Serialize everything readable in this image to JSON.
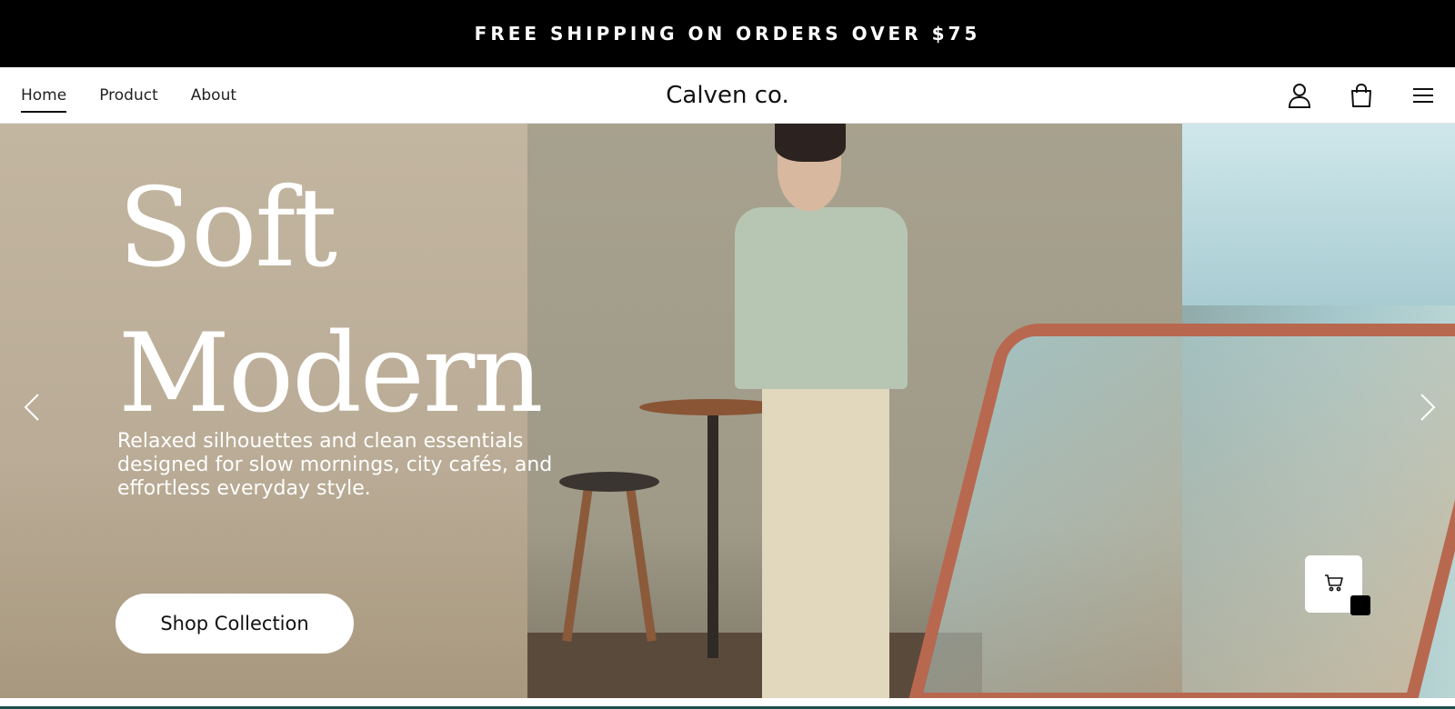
{
  "announcement": {
    "text": "FREE SHIPPING ON ORDERS OVER $75"
  },
  "nav": {
    "links": [
      {
        "label": "Home",
        "active": true
      },
      {
        "label": "Product",
        "active": false
      },
      {
        "label": "About",
        "active": false
      }
    ],
    "brand": "Calven co.",
    "icons": [
      "user-icon",
      "shopping-bag-icon",
      "menu-icon"
    ]
  },
  "hero": {
    "title_line1": "Soft",
    "title_line2": "Modern",
    "subtitle_line1": "Relaxed silhouettes and clean essentials",
    "subtitle_line2": "designed for slow mornings, city cafés, and",
    "subtitle_line3": "effortless everyday style.",
    "cta_label": "Shop Collection",
    "prev_icon": "chevron-left-icon",
    "next_icon": "chevron-right-icon"
  },
  "floating_cart": {
    "icon": "cart-icon"
  },
  "colors": {
    "announce_bg": "#000000",
    "accent_line": "#1f4f4a",
    "text": "#111111"
  }
}
